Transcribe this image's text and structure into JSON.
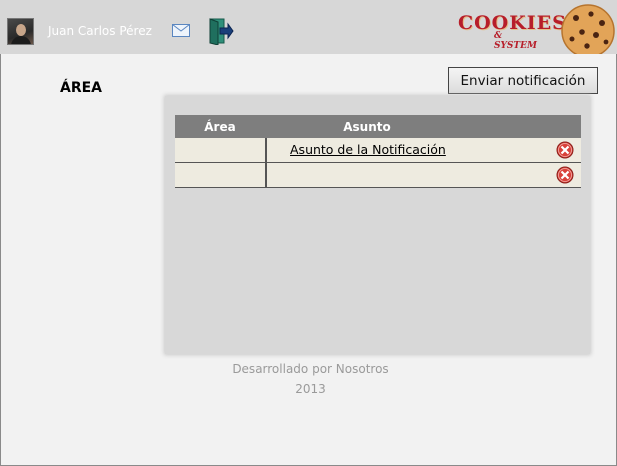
{
  "header": {
    "user_name": "Juan Carlos Pérez",
    "icons": {
      "avatar": "user-photo",
      "mail": "envelope-icon",
      "exit": "exit-door-icon"
    },
    "logo": {
      "main": "COOKIES",
      "sub": "& SYSTEM"
    }
  },
  "actions": {
    "send_notification_label": "Enviar notificación"
  },
  "section": {
    "title": "ÁREA"
  },
  "table": {
    "columns": [
      "Área",
      "Asunto"
    ],
    "rows": [
      {
        "area": "",
        "asunto": "Asunto de la Notificación"
      },
      {
        "area": "",
        "asunto": ""
      }
    ]
  },
  "footer": {
    "line1": "Desarrollado por Nosotros",
    "line2": "2013"
  },
  "colors": {
    "topbar": "#d7d7d7",
    "table_header": "#7e7e7e",
    "row_bg": "#eeebe0",
    "logo_red": "#b71e2a"
  }
}
